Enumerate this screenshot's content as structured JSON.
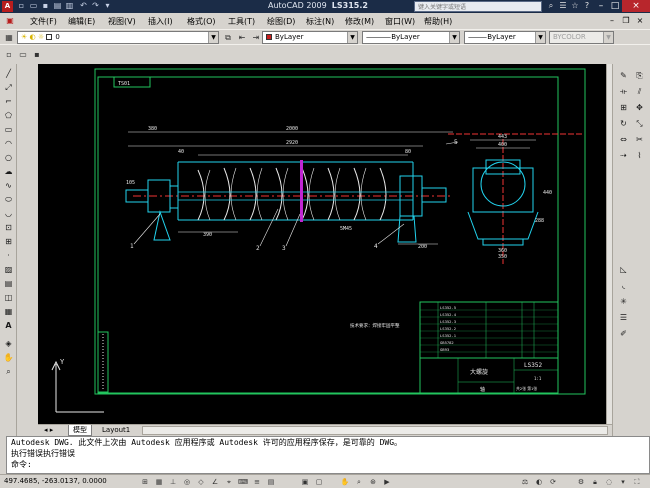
{
  "app": {
    "title": "AutoCAD 2009",
    "filename": "LS315.2",
    "search_placeholder": "键入关键字或短语"
  },
  "menu": [
    "文件(F)",
    "编辑(E)",
    "视图(V)",
    "插入(I)",
    "格式(O)",
    "工具(T)",
    "绘图(D)",
    "标注(N)",
    "修改(M)",
    "窗口(W)",
    "帮助(H)"
  ],
  "toolbar": {
    "layer_value": "0",
    "color_value": "ByLayer",
    "linetype_value": "ByLayer",
    "lineweight_value": "ByLayer",
    "plotstyle_value": "BYCOLOR"
  },
  "drawing": {
    "dims_top": [
      "380",
      "2000",
      "2920",
      "80",
      "40"
    ],
    "dims_side": [
      "443",
      "400",
      "440",
      "360",
      "350",
      "288"
    ],
    "dims_misc": [
      "105",
      "390",
      "5M45",
      "200",
      "A"
    ],
    "callouts": [
      "1",
      "2",
      "3",
      "4",
      "5"
    ],
    "title_block": {
      "name": "大螺旋",
      "part_no": "LS352",
      "material": "轴",
      "scale": "1:1",
      "sheet": "共2张 第1张",
      "note": "技术要求：焊接牢固平整"
    },
    "zone_label": "TS01",
    "bom_rows": [
      "LS352-5",
      "LS352-4",
      "LS352-3",
      "LS352-2",
      "LS352-1",
      "GB5782",
      "GB93"
    ],
    "ucs_label": "Y"
  },
  "tabs": [
    "模型",
    "Layout1"
  ],
  "command_history": [
    "Autodesk DWG.  此文件上次由 Autodesk 应用程序或 Autodesk 许可的应用程序保存，是可靠的 DWG。",
    "执行错误执行错误"
  ],
  "command_prompt": "命令:",
  "status": {
    "coords": "497.4685, -263.0137, 0.0000"
  },
  "colors": {
    "canvas": "#000000",
    "frame": "#22c55e",
    "centerline": "#ef3333",
    "geometry": "#22d3ee",
    "dimension": "#e8e8e8",
    "highlight": "#c026d3"
  }
}
